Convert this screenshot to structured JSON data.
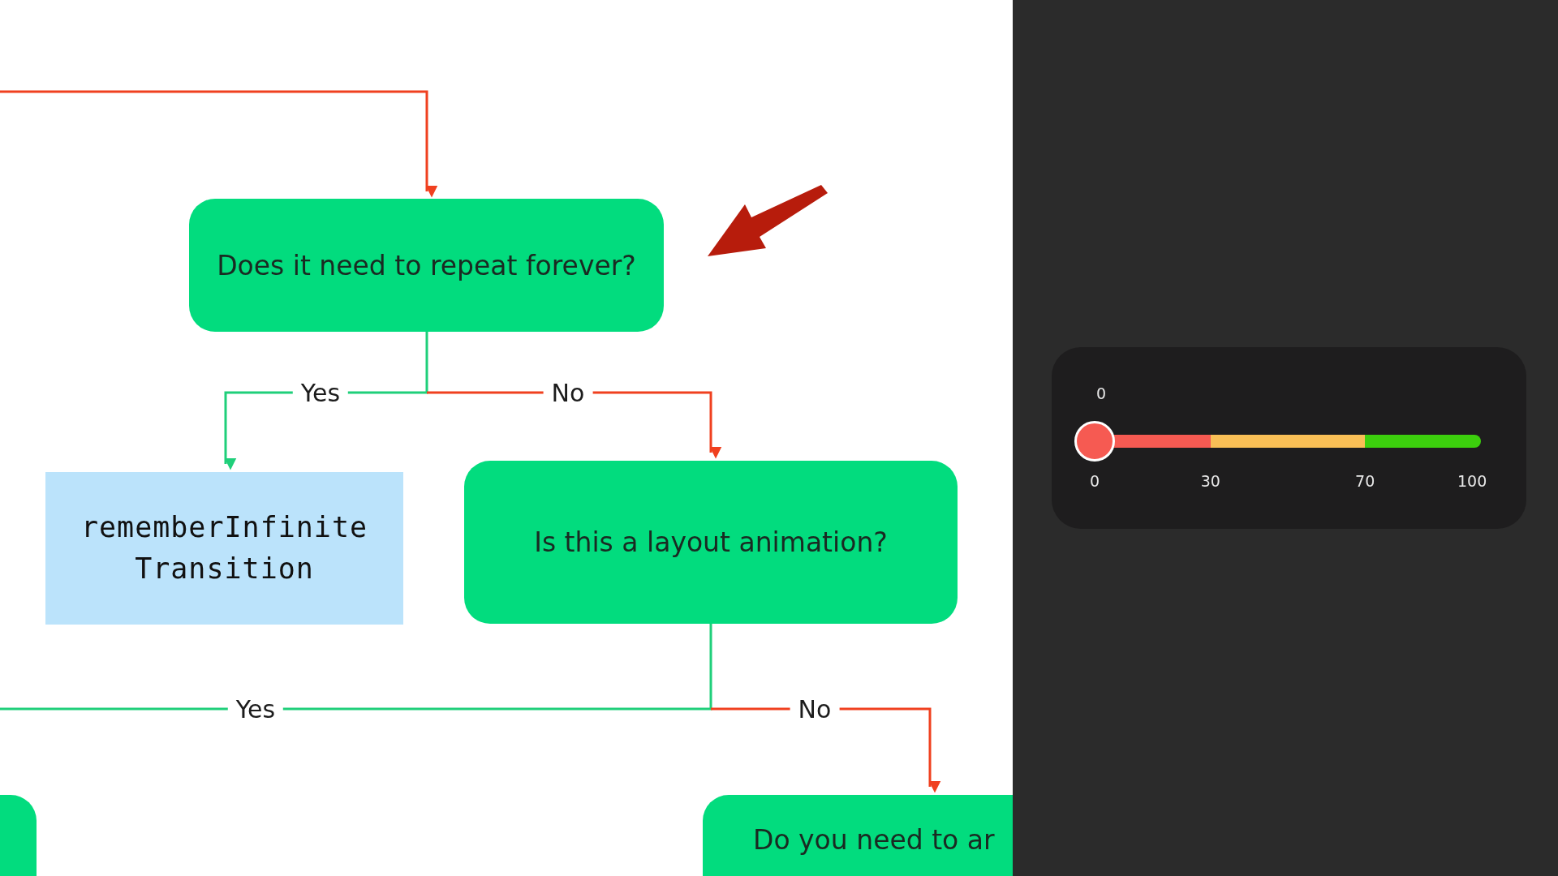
{
  "diagram": {
    "nodes": [
      {
        "kind": "decision",
        "text": "Does it need to repeat forever?"
      },
      {
        "kind": "action",
        "text": "rememberInfinite\nTransition"
      },
      {
        "kind": "decision",
        "text": "Is this a layout animation?"
      },
      {
        "kind": "decision"
      },
      {
        "kind": "decision",
        "text": "Do you need to ar"
      }
    ],
    "edges": [
      {
        "kind": "no"
      },
      {
        "kind": "yes",
        "label": "Yes"
      },
      {
        "kind": "no",
        "label": "No"
      },
      {
        "kind": "yes",
        "label": "Yes"
      },
      {
        "kind": "no",
        "label": "No"
      }
    ]
  },
  "slider": {
    "value_label": "0",
    "level": 0,
    "ticks": [
      "0",
      "30",
      "70",
      "100"
    ],
    "segments": [
      {
        "color": "#f65a52"
      },
      {
        "color": "#f9bf56"
      },
      {
        "color": "#3ccf0d"
      }
    ]
  }
}
